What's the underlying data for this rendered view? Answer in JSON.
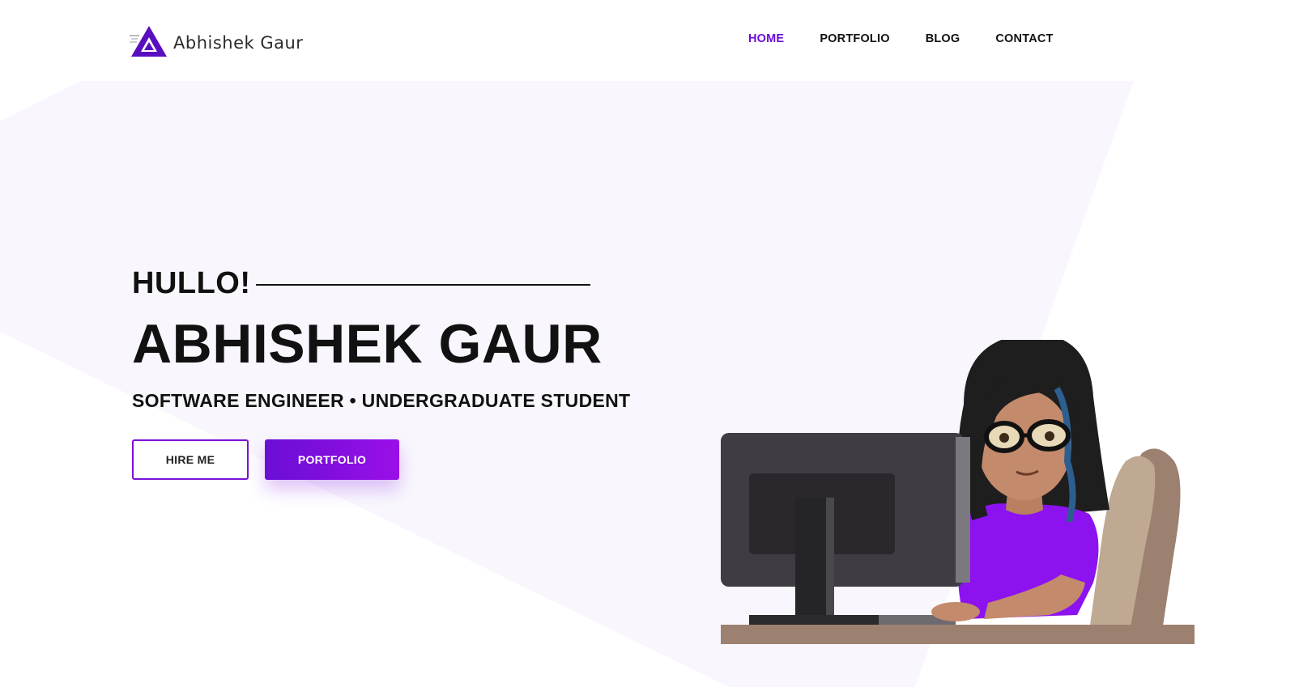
{
  "brand": {
    "name": "Abhishek Gaur",
    "logo_icon": "triangle-logo-icon"
  },
  "nav": {
    "items": [
      {
        "label": "HOME",
        "active": true
      },
      {
        "label": "PORTFOLIO",
        "active": false
      },
      {
        "label": "BLOG",
        "active": false
      },
      {
        "label": "CONTACT",
        "active": false
      }
    ]
  },
  "hero": {
    "greeting": "HULLO!",
    "name": "ABHISHEK GAUR",
    "subtitle": "SOFTWARE ENGINEER • UNDERGRADUATE STUDENT",
    "buttons": {
      "hire_label": "HIRE ME",
      "portfolio_label": "PORTFOLIO"
    }
  },
  "colors": {
    "accent": "#6a0dd6",
    "accent_gradient_end": "#9a0fe8",
    "background_shape": "#f9f7fd",
    "text": "#111111"
  },
  "illustration": {
    "description_icon": "developer-at-computer-illustration"
  }
}
